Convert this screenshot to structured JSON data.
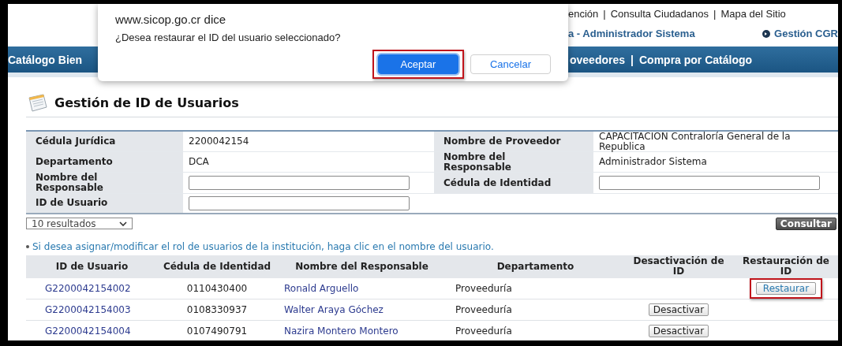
{
  "header": {
    "top_links": [
      {
        "label": "ención"
      },
      {
        "label": "Consulta Ciudadanos"
      },
      {
        "label": "Mapa del Sitio"
      }
    ],
    "separator": "|",
    "user_line": "a - Administrador Sistema",
    "system_link": "Gestión CGR",
    "nav": {
      "left": "Catálogo Bien",
      "right": [
        "oveedores",
        "Compra por Catálogo"
      ]
    }
  },
  "dialog": {
    "origin": "www.sicop.go.cr dice",
    "message": "¿Desea restaurar el ID del usuario seleccionado?",
    "buttons": [
      {
        "label": "Aceptar",
        "kind": "primary",
        "highlighted": true
      },
      {
        "label": "Cancelar",
        "kind": "secondary",
        "highlighted": false
      }
    ]
  },
  "page": {
    "title": "Gestión de ID de Usuarios"
  },
  "form": {
    "rows": [
      [
        {
          "label": "Cédula Jurídica",
          "kind": "text",
          "value": "2200042154"
        },
        {
          "label": "Nombre de Proveedor",
          "kind": "text",
          "value": "CAPACITACION Contraloría General de la Republica"
        }
      ],
      [
        {
          "label": "Departamento",
          "kind": "text",
          "value": "DCA"
        },
        {
          "label": "Nombre del Responsable",
          "kind": "text",
          "value": "Administrador Sistema"
        }
      ],
      [
        {
          "label": "Nombre del Responsable",
          "kind": "input"
        },
        {
          "label": "Cédula de Identidad",
          "kind": "input"
        }
      ],
      [
        {
          "label": "ID de Usuario",
          "kind": "input"
        }
      ]
    ],
    "page_size": "10 resultados",
    "search_button": "Consultar"
  },
  "hint": "Si desea asignar/modificar el rol de usuarios de la institución, haga clic en el nombre del usuario.",
  "table": {
    "columns": [
      "ID de Usuario",
      "Cédula de Identidad",
      "Nombre del Responsable",
      "Departamento",
      "Desactivación de ID",
      "Restauración de ID"
    ],
    "rows": [
      {
        "user_id": "G2200042154002",
        "cedula": "0110430400",
        "name": "Ronald Arguello",
        "department": "Proveeduría",
        "restore": "Restaurar",
        "highlighted": true
      },
      {
        "user_id": "G2200042154003",
        "cedula": "0108330937",
        "name": "Walter Araya Góchez",
        "department": "Proveeduría",
        "deactivate": "Desactivar",
        "highlighted": false
      },
      {
        "user_id": "G2200042154004",
        "cedula": "0107490791",
        "name": "Nazira Montero Montero",
        "department": "Proveeduría",
        "deactivate": "Desactivar",
        "highlighted": false
      }
    ]
  }
}
